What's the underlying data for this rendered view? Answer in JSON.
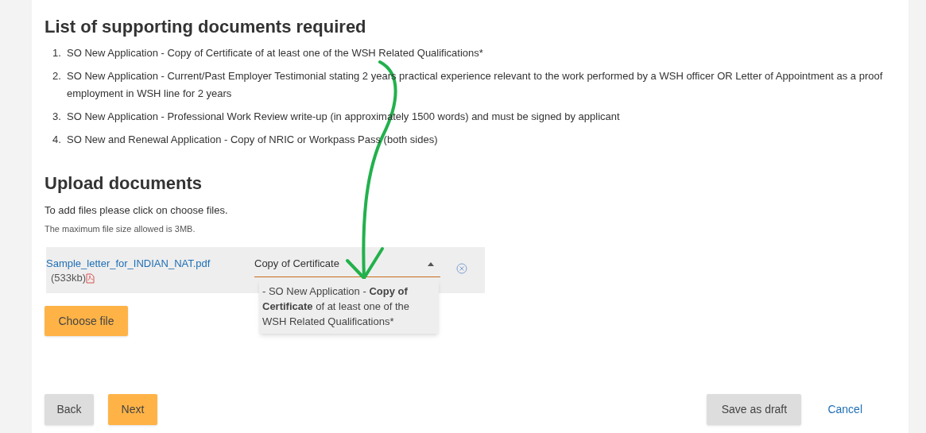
{
  "supporting_documents": {
    "title": "List of supporting documents required",
    "items": [
      {
        "number": "1.",
        "text": "SO New Application - Copy of Certificate of at least one of the WSH Related Qualifications*"
      },
      {
        "number": "2.",
        "text": "SO New Application - Current/Past Employer Testimonial stating 2 years practical experience relevant to the work performed by a WSH officer OR Letter of Appointment as a proof employment in WSH line for 2 years"
      },
      {
        "number": "3.",
        "text": "SO New Application - Professional Work Review write-up (in approximately 1500 words) and must be signed by applicant"
      },
      {
        "number": "4.",
        "text": "SO New and Renewal Application - Copy of NRIC or Workpass Pass (both sides)"
      }
    ]
  },
  "upload": {
    "title": "Upload documents",
    "instruction": "To add files please click on choose files.",
    "size_note": "The maximum file size allowed is 3MB.",
    "files": [
      {
        "name": "Sample_letter_for_INDIAN_NAT.pdf",
        "size": "(533kb)",
        "document_type": {
          "value": "Copy of Certificate",
          "expanded": true,
          "options": [
            "- SO New Application - **Copy of Certificate** of at least one of the WSH Related Qualifications*"
          ]
        }
      }
    ],
    "choose_button": "Choose file"
  },
  "footer": {
    "back": "Back",
    "next": "Next",
    "save_draft": "Save as draft",
    "cancel": "Cancel"
  }
}
